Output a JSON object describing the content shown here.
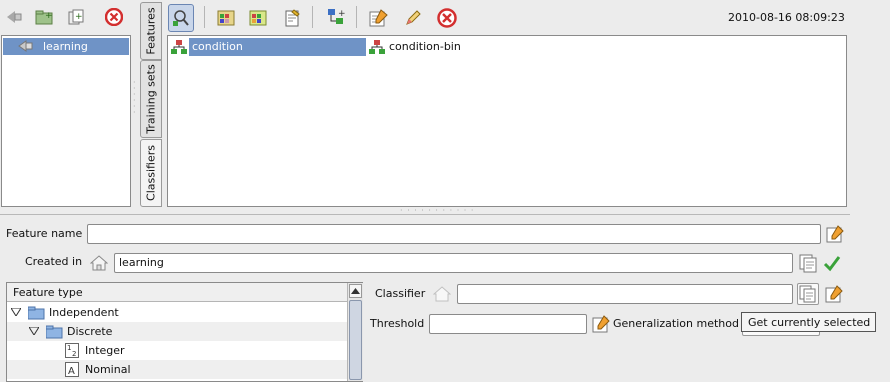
{
  "left_toolbar": {
    "icons": [
      "navigate-back-icon",
      "new-folder-icon",
      "copy-node-icon",
      "delete-icon"
    ]
  },
  "left_tree": {
    "items": [
      {
        "label": "learning",
        "selected": true
      }
    ]
  },
  "side_tabs": [
    {
      "label": "Features",
      "active": false
    },
    {
      "label": "Training sets",
      "active": false
    },
    {
      "label": "Classifiers",
      "active": true
    }
  ],
  "main_toolbar": {
    "icons": [
      "zoom-select-icon",
      "palette-a-icon",
      "palette-b-icon",
      "edit-document-icon",
      "add-node-icon",
      "notepad-edit-icon",
      "pencil-icon",
      "stop-icon"
    ],
    "timestamp": "2010-08-16 08:09:23"
  },
  "feature_list": {
    "items": [
      {
        "label": "condition",
        "selected": true
      },
      {
        "label": "condition-bin",
        "selected": false
      }
    ]
  },
  "form": {
    "feature_name_label": "Feature name",
    "feature_name_value": "",
    "created_in_label": "Created in",
    "created_in_value": "learning",
    "classifier_label": "Classifier",
    "classifier_value": "",
    "threshold_label": "Threshold",
    "threshold_value": "",
    "generalization_label": "Generalization method",
    "tooltip": "Get currently selected"
  },
  "feature_type_tree": {
    "header": "Feature type",
    "rows": [
      {
        "label": "Independent",
        "icon": "folder-icon",
        "expanded": true,
        "level": 0
      },
      {
        "label": "Discrete",
        "icon": "folder-icon",
        "expanded": true,
        "level": 1
      },
      {
        "label": "Integer",
        "icon": "integer-type-icon",
        "level": 2
      },
      {
        "label": "Nominal",
        "icon": "nominal-type-icon",
        "level": 2
      }
    ]
  },
  "colors": {
    "selection": "#6f93c6",
    "accent_red": "#d32f2f",
    "accent_green": "#3aa23a"
  }
}
